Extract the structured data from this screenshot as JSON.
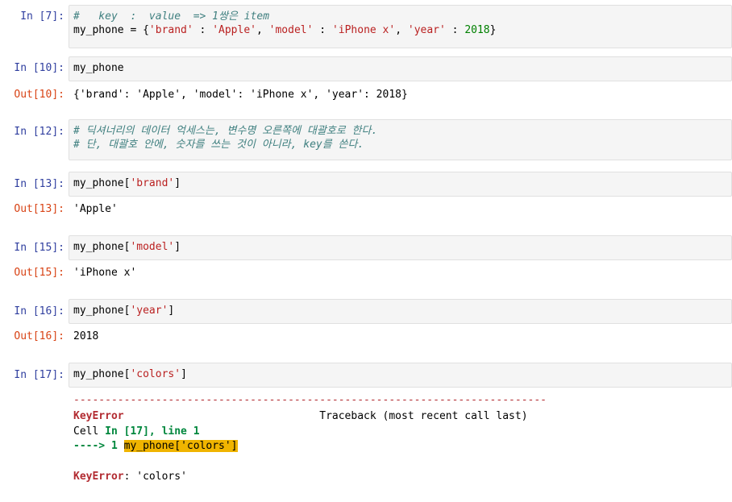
{
  "cells": [
    {
      "id": "c7",
      "prompt": "In [7]:",
      "lines": [
        [
          {
            "t": "#   key  :  value  => 1쌍은 item",
            "c": "cm"
          }
        ],
        [
          {
            "t": "my_phone = {"
          },
          {
            "t": "'brand'",
            "c": "s"
          },
          {
            "t": " : "
          },
          {
            "t": "'Apple'",
            "c": "s"
          },
          {
            "t": ", "
          },
          {
            "t": "'model'",
            "c": "s"
          },
          {
            "t": " : "
          },
          {
            "t": "'iPhone x'",
            "c": "s"
          },
          {
            "t": ", "
          },
          {
            "t": "'year'",
            "c": "s"
          },
          {
            "t": " : "
          },
          {
            "t": "2018",
            "c": "n"
          },
          {
            "t": "}"
          }
        ]
      ]
    },
    {
      "id": "c10",
      "prompt": "In [10]:",
      "lines": [
        [
          {
            "t": "my_phone"
          }
        ]
      ],
      "out_prompt": "Out[10]:",
      "out": "{'brand': 'Apple', 'model': 'iPhone x', 'year': 2018}"
    },
    {
      "id": "c12",
      "prompt": "In [12]:",
      "lines": [
        [
          {
            "t": "# 딕셔너리의 데이터 억세스는, 변수명 오른쪽에 대괄호로 한다.",
            "c": "cm"
          }
        ],
        [
          {
            "t": "# 단, 대괄호 안에, 숫자를 쓰는 것이 아니라, key를 쓴다.",
            "c": "cm"
          }
        ]
      ]
    },
    {
      "id": "c13",
      "prompt": "In [13]:",
      "lines": [
        [
          {
            "t": "my_phone["
          },
          {
            "t": "'brand'",
            "c": "s"
          },
          {
            "t": "]"
          }
        ]
      ],
      "out_prompt": "Out[13]:",
      "out": "'Apple'"
    },
    {
      "id": "c15",
      "prompt": "In [15]:",
      "lines": [
        [
          {
            "t": "my_phone["
          },
          {
            "t": "'model'",
            "c": "s"
          },
          {
            "t": "]"
          }
        ]
      ],
      "out_prompt": "Out[15]:",
      "out": "'iPhone x'"
    },
    {
      "id": "c16",
      "prompt": "In [16]:",
      "lines": [
        [
          {
            "t": "my_phone["
          },
          {
            "t": "'year'",
            "c": "s"
          },
          {
            "t": "]"
          }
        ]
      ],
      "out_prompt": "Out[16]:",
      "out": "2018"
    },
    {
      "id": "c17",
      "prompt": "In [17]:",
      "lines": [
        [
          {
            "t": "my_phone["
          },
          {
            "t": "'colors'",
            "c": "s"
          },
          {
            "t": "]"
          }
        ]
      ]
    }
  ],
  "error": {
    "dashes": "---------------------------------------------------------------------------",
    "name": "KeyError",
    "traceback_label": "                               Traceback (most recent call last)",
    "cell_prefix": "Cell ",
    "cell_ref": "In [17], line 1",
    "arrow": "----> 1 ",
    "code": "my_phone['colors']",
    "final_name": "KeyError",
    "final_msg": ": 'colors'"
  }
}
